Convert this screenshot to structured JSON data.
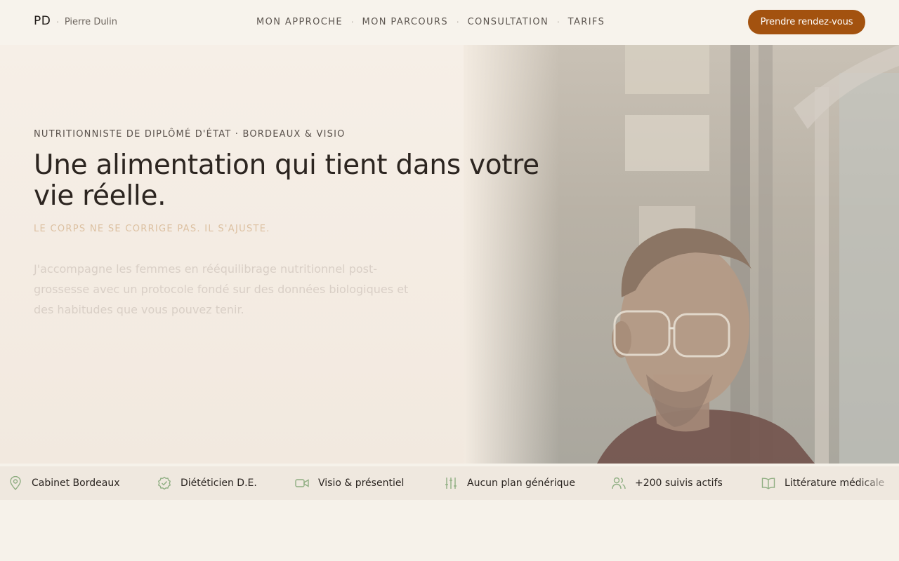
{
  "header": {
    "logo_mark": "PD",
    "logo_separator": "·",
    "logo_name": "Pierre Dulin",
    "nav": [
      "MON APPROCHE",
      "MON PARCOURS",
      "CONSULTATION",
      "TARIFS"
    ],
    "nav_separator": "·",
    "cta_label": "Prendre rendez-vous"
  },
  "hero": {
    "eyebrow": "NUTRITIONNISTE DE DIPLÔMÉ D'ÉTAT · BORDEAUX & VISIO",
    "title": "Une alimentation qui tient dans votre vie réelle.",
    "tagline": "LE CORPS NE SE CORRIGE PAS. IL S'AJUSTE.",
    "lead": "J'accompagne les femmes en rééquilibrage nutritionnel post-grossesse avec un protocole fondé sur des données biologiques et des habitudes que vous pouvez tenir."
  },
  "trust": [
    {
      "icon": "map-pin-icon",
      "label": "Cabinet Bordeaux"
    },
    {
      "icon": "badge-check-icon",
      "label": "Diététicien D.E."
    },
    {
      "icon": "video-camera-icon",
      "label": "Visio & présentiel"
    },
    {
      "icon": "sliders-icon",
      "label": "Aucun plan générique"
    },
    {
      "icon": "users-icon",
      "label": "+200 suivis actifs"
    },
    {
      "icon": "open-book-icon",
      "label": "Littérature médicale"
    }
  ],
  "colors": {
    "accent": "#a3520f",
    "background": "#f6f2ea",
    "icon_green": "#8fae82",
    "tagline": "#dcc0a1"
  }
}
